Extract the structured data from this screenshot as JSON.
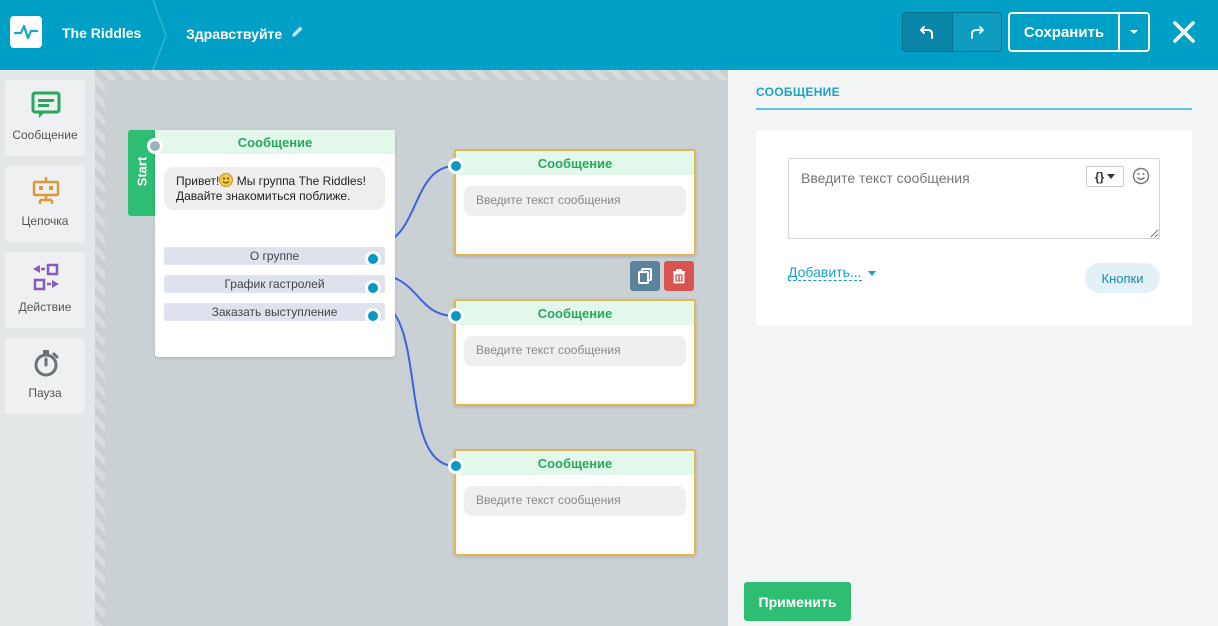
{
  "header": {
    "bot_name": "The Riddles",
    "flow_title": "Здравствуйте",
    "save_label": "Сохранить",
    "icons": [
      "pulse-icon",
      "pencil-icon",
      "undo-icon",
      "redo-icon",
      "chevron-down-icon",
      "close-icon"
    ],
    "bg_color": "#009fc6"
  },
  "sidebar": {
    "items": [
      {
        "label": "Сообщение",
        "icon": "message-icon",
        "color": "#2aa65f"
      },
      {
        "label": "Цепочка",
        "icon": "chain-icon",
        "color": "#d99a3c"
      },
      {
        "label": "Действие",
        "icon": "action-icon",
        "color": "#8a5bbf"
      },
      {
        "label": "Пауза",
        "icon": "stopwatch-icon",
        "color": "#6a7378"
      }
    ]
  },
  "canvas": {
    "start_label": "Start",
    "main_node": {
      "title": "Сообщение",
      "text_before_emoji": "Привет!",
      "text_after_emoji": " Мы группа The Riddles! Давайте знакомиться поближе.",
      "quick_replies": [
        "О группе",
        "График гастролей",
        "Заказать выступление"
      ]
    },
    "child_nodes": [
      {
        "title": "Сообщение",
        "placeholder": "Введите текст сообщения"
      },
      {
        "title": "Сообщение",
        "placeholder": "Введите текст сообщения"
      },
      {
        "title": "Сообщение",
        "placeholder": "Введите текст сообщения"
      }
    ],
    "node_actions": [
      "copy-icon",
      "trash-icon"
    ]
  },
  "panel": {
    "title": "СООБЩЕНИЕ",
    "textarea_placeholder": "Введите текст сообщения",
    "variables_label": "{}",
    "add_label": "Добавить...",
    "buttons_label": "Кнопки",
    "apply_label": "Применить",
    "accent_color": "#2dbd73"
  }
}
